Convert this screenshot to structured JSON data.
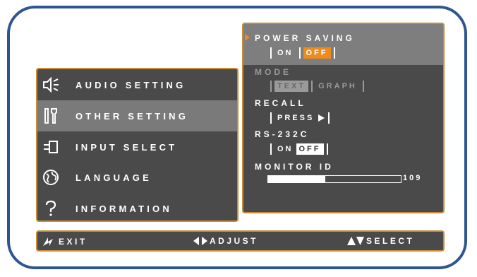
{
  "menu": {
    "items": [
      {
        "label": "AUDIO SETTING",
        "icon": "speaker-icon",
        "selected": false
      },
      {
        "label": "OTHER SETTING",
        "icon": "tools-icon",
        "selected": true
      },
      {
        "label": "INPUT SELECT",
        "icon": "plug-icon",
        "selected": false
      },
      {
        "label": "LANGUAGE",
        "icon": "globe-icon",
        "selected": false
      },
      {
        "label": "INFORMATION",
        "icon": "question-icon",
        "selected": false
      }
    ]
  },
  "panel": {
    "power_saving": {
      "label": "POWER SAVING",
      "options": [
        "ON",
        "OFF"
      ],
      "selected": "OFF"
    },
    "mode": {
      "label": "MODE",
      "options": [
        "TEXT",
        "GRAPH"
      ],
      "selected": "TEXT",
      "disabled": true
    },
    "recall": {
      "label": "RECALL",
      "button": "PRESS"
    },
    "rs232c": {
      "label": "RS-232C",
      "options": [
        "ON",
        "OFF"
      ],
      "selected": "OFF"
    },
    "monitor_id": {
      "label": "MONITOR ID",
      "value": "109",
      "fraction": 0.43
    }
  },
  "footer": {
    "exit": "EXIT",
    "adjust": "ADJUST",
    "select": "SELECT"
  },
  "colors": {
    "frame": "#2f5590",
    "border": "#c98a3a",
    "panel_bg": "#4a4a4a",
    "highlight": "#7a7a7a",
    "accent": "#f08a1a"
  }
}
